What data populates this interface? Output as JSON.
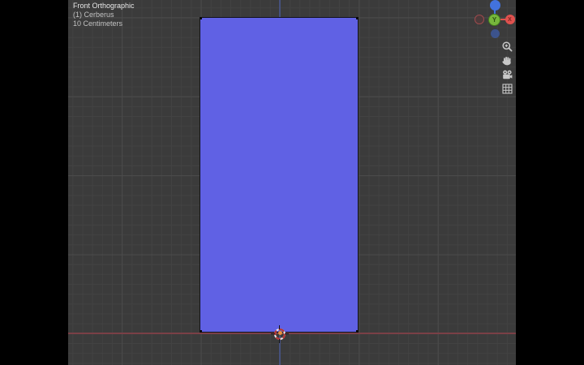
{
  "viewport": {
    "header": {
      "view_mode": "Front Orthographic",
      "collection": "(1) Cerberus",
      "grid_scale": "10 Centimeters"
    },
    "background_color": "#3b3b3b",
    "grid_minor_color": "#424242",
    "grid_major_color": "#4b4b4b"
  },
  "object": {
    "fill_color": "#6061e4",
    "edge_color": "#12121c",
    "origin_color": "#e8923f"
  },
  "axes": {
    "x_line_color": "#7a4046",
    "z_line_color": "#46517d"
  },
  "gizmo": {
    "x_pos_label": "X",
    "y_pos_label": "Y",
    "x_color": "#e0514e",
    "y_color": "#77b73c",
    "z_color": "#4272dd"
  },
  "toolbar": {
    "icons": [
      "zoom",
      "pan",
      "camera-view",
      "toggle-grid-view"
    ]
  }
}
